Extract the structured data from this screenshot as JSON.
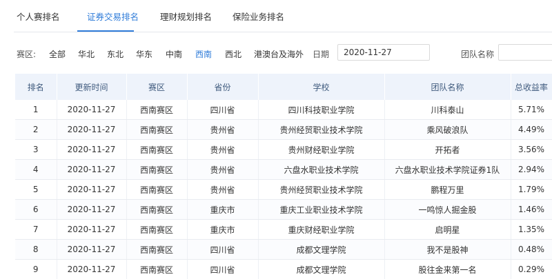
{
  "tabs": [
    {
      "label": "个人赛排名",
      "active": false
    },
    {
      "label": "证券交易排名",
      "active": true
    },
    {
      "label": "理财规划排名",
      "active": false
    },
    {
      "label": "保险业务排名",
      "active": false
    }
  ],
  "filters": {
    "region_label": "赛区:",
    "regions": [
      {
        "label": "全部",
        "active": false
      },
      {
        "label": "华北",
        "active": false
      },
      {
        "label": "东北",
        "active": false
      },
      {
        "label": "华东",
        "active": false
      },
      {
        "label": "中南",
        "active": false
      },
      {
        "label": "西南",
        "active": true
      },
      {
        "label": "西北",
        "active": false
      },
      {
        "label": "港澳台及海外",
        "active": false
      }
    ],
    "date_label": "日期",
    "date_value": "2020-11-27",
    "team_label": "团队名称",
    "team_value": ""
  },
  "table": {
    "headers": [
      "排名",
      "更新时间",
      "赛区",
      "省份",
      "学校",
      "团队名称",
      "总收益率"
    ],
    "rows": [
      [
        "1",
        "2020-11-27",
        "西南赛区",
        "四川省",
        "四川科技职业学院",
        "川科泰山",
        "5.71%"
      ],
      [
        "2",
        "2020-11-27",
        "西南赛区",
        "贵州省",
        "贵州经贸职业技术学院",
        "乘风破浪队",
        "4.49%"
      ],
      [
        "3",
        "2020-11-27",
        "西南赛区",
        "贵州省",
        "贵州财经职业学院",
        "开拓者",
        "3.56%"
      ],
      [
        "4",
        "2020-11-27",
        "西南赛区",
        "贵州省",
        "六盘水职业技术学院",
        "六盘水职业技术学院证券1队",
        "2.94%"
      ],
      [
        "5",
        "2020-11-27",
        "西南赛区",
        "贵州省",
        "贵州经贸职业技术学院",
        "鹏程万里",
        "1.79%"
      ],
      [
        "6",
        "2020-11-27",
        "西南赛区",
        "重庆市",
        "重庆工业职业技术学院",
        "一鸣惊人掘金股",
        "1.46%"
      ],
      [
        "7",
        "2020-11-27",
        "西南赛区",
        "重庆市",
        "重庆财经职业学院",
        "启明星",
        "1.35%"
      ],
      [
        "8",
        "2020-11-27",
        "西南赛区",
        "四川省",
        "成都文理学院",
        "我不是股神",
        "0.48%"
      ],
      [
        "9",
        "2020-11-27",
        "西南赛区",
        "四川省",
        "成都文理学院",
        "股往金来第一名",
        "0.29%"
      ]
    ]
  },
  "colors": {
    "accent": "#2f7cd9",
    "header_bg": "#eef3fb",
    "header_text": "#3f5a7d"
  }
}
